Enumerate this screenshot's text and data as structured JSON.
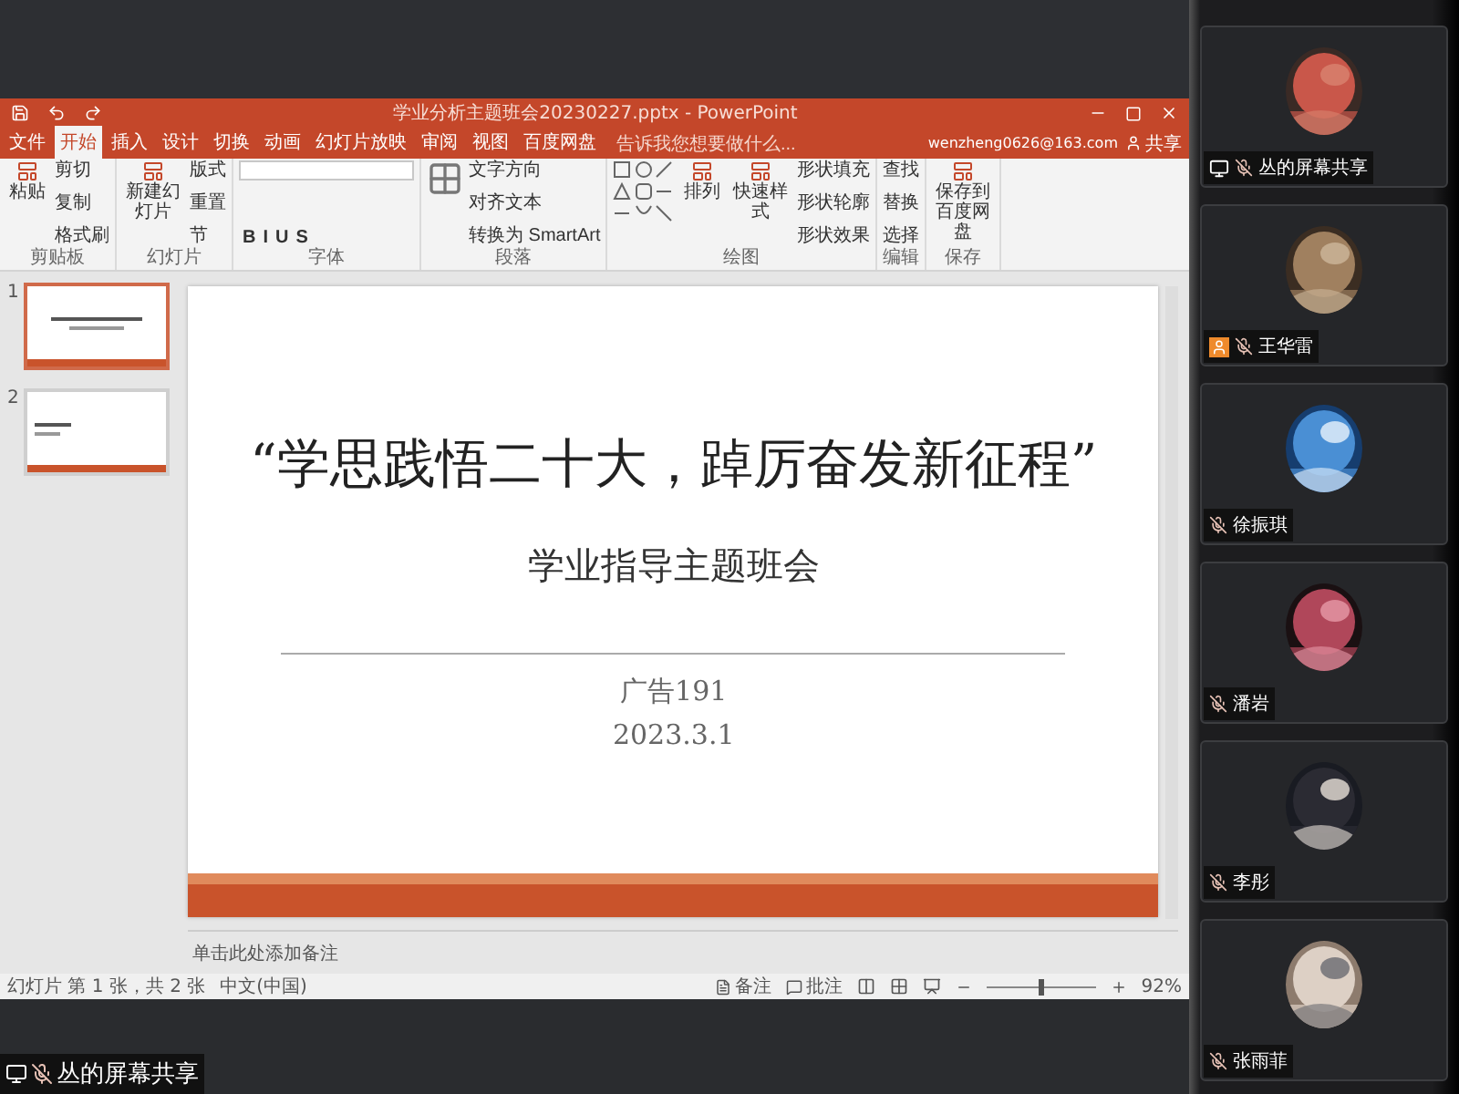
{
  "window": {
    "title": "学业分析主题班会20230227.pptx - PowerPoint",
    "account": "wenzheng0626@163.com",
    "share": "共享"
  },
  "tabs": [
    {
      "label": "文件",
      "selected": false
    },
    {
      "label": "开始",
      "selected": true
    },
    {
      "label": "插入",
      "selected": false
    },
    {
      "label": "设计",
      "selected": false
    },
    {
      "label": "切换",
      "selected": false
    },
    {
      "label": "动画",
      "selected": false
    },
    {
      "label": "幻灯片放映",
      "selected": false
    },
    {
      "label": "审阅",
      "selected": false
    },
    {
      "label": "视图",
      "selected": false
    },
    {
      "label": "百度网盘",
      "selected": false
    }
  ],
  "tell_me": {
    "placeholder": "告诉我您想要做什么..."
  },
  "ribbon": [
    {
      "label": "剪贴板",
      "kind": "buttons",
      "large": [
        "粘贴"
      ],
      "small": [
        "剪切",
        "复制",
        "格式刷"
      ]
    },
    {
      "label": "幻灯片",
      "kind": "buttons",
      "large": [
        "新建幻灯片"
      ],
      "small": [
        "版式",
        "重置",
        "节"
      ]
    },
    {
      "label": "字体",
      "kind": "font",
      "formats": [
        "B",
        "I",
        "U",
        "S"
      ]
    },
    {
      "label": "段落",
      "kind": "paragraph",
      "small": [
        "文字方向",
        "对齐文本",
        "转换为 SmartArt"
      ]
    },
    {
      "label": "绘图",
      "kind": "drawing",
      "large": [
        "排列",
        "快速样式"
      ],
      "small": [
        "形状填充",
        "形状轮廓",
        "形状效果"
      ]
    },
    {
      "label": "编辑",
      "kind": "buttons",
      "small": [
        "查找",
        "替换",
        "选择"
      ]
    },
    {
      "label": "保存",
      "kind": "buttons",
      "large": [
        "保存到百度网盘"
      ]
    }
  ],
  "thumbnails": [
    {
      "number": "1",
      "selected": true
    },
    {
      "number": "2",
      "selected": false
    }
  ],
  "slide": {
    "title": "“学思践悟二十大，踔厉奋发新征程”",
    "subtitle": "学业指导主题班会",
    "class": "广告191",
    "date": "2023.3.1"
  },
  "notes": {
    "placeholder": "单击此处添加备注"
  },
  "status_bar": {
    "slide_count": "幻灯片 第 1 张，共 2 张",
    "language": "中文(中国)",
    "notes": "备注",
    "comments": "批注",
    "zoom": "92%",
    "zoom_slider": {
      "level": 0.5
    }
  },
  "share_label": "丛的屏幕共享",
  "participants": [
    {
      "name": "丛的屏幕共享",
      "kind": "screen"
    },
    {
      "name": "王华雷",
      "kind": "person"
    },
    {
      "name": "徐振琪",
      "kind": "none"
    },
    {
      "name": "潘岩",
      "kind": "none"
    },
    {
      "name": "李彤",
      "kind": "none"
    },
    {
      "name": "张雨菲",
      "kind": "none"
    }
  ]
}
